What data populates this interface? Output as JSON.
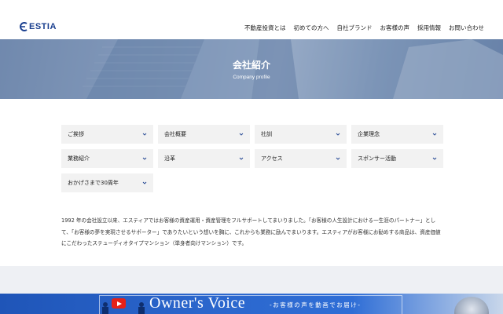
{
  "brand": {
    "name": "ESTIA",
    "color": "#1a3f8f"
  },
  "nav": [
    "不動産投資とは",
    "初めての方へ",
    "自社ブランド",
    "お客様の声",
    "採用情報",
    "お問い合わせ"
  ],
  "hero": {
    "title": "会社紹介",
    "subtitle": "Company profile"
  },
  "menu": [
    "ご挨拶",
    "会社概要",
    "社訓",
    "企業理念",
    "業務紹介",
    "沿革",
    "アクセス",
    "スポンサー活動",
    "おかげさまで30周年"
  ],
  "menu_icon": "chevron-down-icon",
  "intro": {
    "text": "1992 年の会社設立以来、エスティアではお客様の資産運用・資産管理をフルサポートしてまいりました。「お客様の人生設計における一生涯のパートナー」として、「お客様の夢を実現させるサポーター」でありたいという想いを胸に、これからも業務に励んでまいります。エスティアがお客様にお勧めする商品は、資産価値にこだわったステューディオタイプマンション（単身者向けマンション）です。"
  },
  "banner": {
    "title": "Owner's Voice",
    "subtitle": "-お客様の声を動画でお届け-"
  },
  "colors": {
    "accent": "#1a3f8f",
    "banner": "#2b66cc",
    "youtube": "#e62117"
  }
}
